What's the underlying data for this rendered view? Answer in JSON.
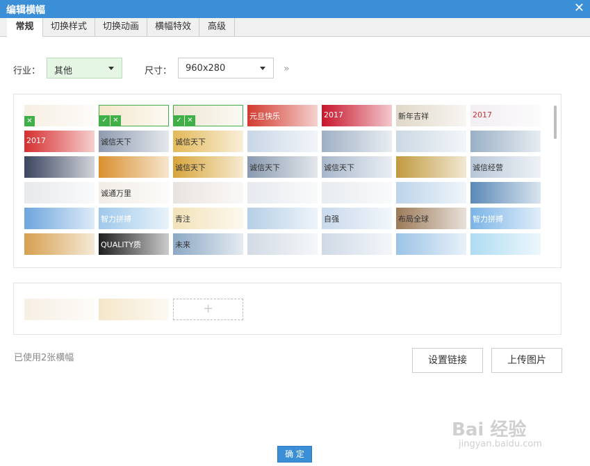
{
  "window": {
    "title": "编辑横幅"
  },
  "tabs": [
    {
      "label": "常规",
      "active": true
    },
    {
      "label": "切换样式"
    },
    {
      "label": "切换动画"
    },
    {
      "label": "横幅特效"
    },
    {
      "label": "高级"
    }
  ],
  "form": {
    "industry_label": "行业：",
    "industry_value": "其他",
    "size_label": "尺寸：",
    "size_value": "960x280"
  },
  "gallery": {
    "colors": [
      "#f6efe3",
      "#f4e6c9",
      "#eee6d3",
      "#d23a2f",
      "#c8152b",
      "#e0d8c8",
      "#f2eef2",
      "#d62f2f",
      "#8e9bb0",
      "#e3b95a",
      "#c9d6e6",
      "#9fb0c4",
      "#cbd8e3",
      "#9ab0c6",
      "#3c4560",
      "#d9902e",
      "#d8a53a",
      "#8a9ab0",
      "#a7b7cb",
      "#c19a40",
      "#b8c7d8",
      "#e7e9ec",
      "#f2ede6",
      "#e9e3df",
      "#e6eaee",
      "#e8ecef",
      "#bcd4ea",
      "#5b89b8",
      "#6ea6dd",
      "#9ec8ea",
      "#f2e2b8",
      "#b5cfe6",
      "#c8d9ec",
      "#9c7a5a",
      "#7bb4e6",
      "#d6a050",
      "#1f1f1f",
      "#8ca8c4",
      "#d2dae4",
      "#cfd9e6",
      "#9cc3e6",
      "#aedcf2"
    ],
    "texts": [
      "",
      "",
      "",
      "元旦快乐",
      "2017",
      "新年吉祥",
      "2017",
      "2017",
      "诚信天下",
      "诚信天下",
      "",
      "",
      "",
      "",
      "",
      "",
      "诚信天下",
      "诚信天下",
      "诚信天下",
      "",
      "诚信经营",
      "",
      "诚通万里",
      "",
      "",
      "",
      "",
      "",
      "",
      "智力拼搏",
      "青注",
      "",
      "自强",
      "布局全球",
      "智力拼搏",
      "",
      "QUALITY质",
      "未来",
      "",
      "",
      "",
      ""
    ],
    "text_colors": [
      "#a33",
      "#a33",
      "#a33",
      "#fff",
      "#fff",
      "#333",
      "#c33",
      "#fff",
      "#333",
      "#333",
      "#333",
      "#333",
      "#333",
      "#333",
      "#fff",
      "#fff",
      "#333",
      "#333",
      "#333",
      "#333",
      "#333",
      "#333",
      "#333",
      "#333",
      "#333",
      "#333",
      "#333",
      "#333",
      "#fff",
      "#fff",
      "#333",
      "#333",
      "#333",
      "#333",
      "#fff",
      "#333",
      "#fff",
      "#333",
      "#333",
      "#333",
      "#333",
      "#333"
    ],
    "selected_indices": [
      1,
      2
    ]
  },
  "selected_banners": {
    "colors": [
      "#f6efe3",
      "#f4e6c9"
    ]
  },
  "status": {
    "used_count": "已使用2张横幅"
  },
  "buttons": {
    "set_link": "设置链接",
    "upload": "上传图片",
    "confirm": "确 定"
  },
  "watermark": {
    "brand": "Bai 经验",
    "url": "jingyan.baidu.com"
  }
}
